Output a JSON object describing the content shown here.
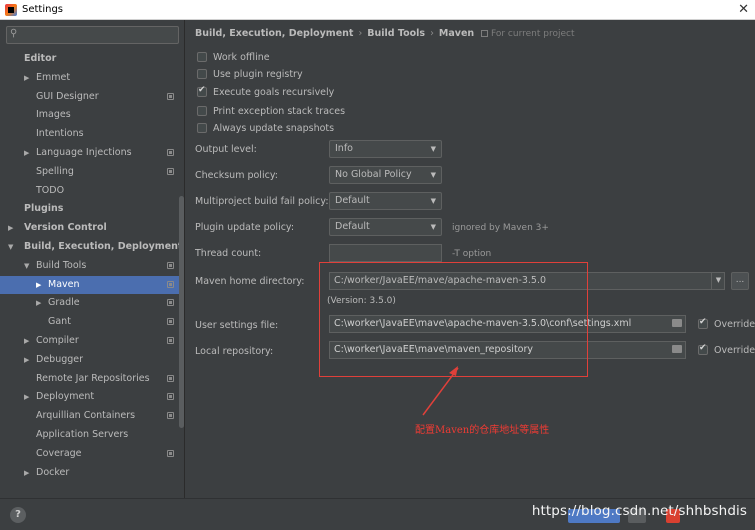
{
  "window": {
    "title": "Settings"
  },
  "search": {
    "placeholder": ""
  },
  "sidebar": {
    "items": [
      {
        "label": "Editor",
        "level": 0,
        "bold": true
      },
      {
        "label": "Emmet",
        "level": 1,
        "arrow": "right"
      },
      {
        "label": "GUI Designer",
        "level": 1,
        "copy": true
      },
      {
        "label": "Images",
        "level": 1
      },
      {
        "label": "Intentions",
        "level": 1
      },
      {
        "label": "Language Injections",
        "level": 1,
        "arrow": "right",
        "copy": true
      },
      {
        "label": "Spelling",
        "level": 1,
        "copy": true
      },
      {
        "label": "TODO",
        "level": 1
      },
      {
        "label": "Plugins",
        "level": 0,
        "bold": true
      },
      {
        "label": "Version Control",
        "level": 0,
        "bold": true,
        "arrow": "right"
      },
      {
        "label": "Build, Execution, Deployment",
        "level": 0,
        "bold": true,
        "arrow": "down"
      },
      {
        "label": "Build Tools",
        "level": 1,
        "arrow": "down",
        "copy": true
      },
      {
        "label": "Maven",
        "level": 2,
        "arrow": "right",
        "copy": true,
        "selected": true
      },
      {
        "label": "Gradle",
        "level": 2,
        "arrow": "right",
        "copy": true
      },
      {
        "label": "Gant",
        "level": 2,
        "copy": true
      },
      {
        "label": "Compiler",
        "level": 1,
        "arrow": "right",
        "copy": true
      },
      {
        "label": "Debugger",
        "level": 1,
        "arrow": "right"
      },
      {
        "label": "Remote Jar Repositories",
        "level": 1,
        "copy": true
      },
      {
        "label": "Deployment",
        "level": 1,
        "arrow": "right",
        "copy": true
      },
      {
        "label": "Arquillian Containers",
        "level": 1,
        "copy": true
      },
      {
        "label": "Application Servers",
        "level": 1
      },
      {
        "label": "Coverage",
        "level": 1,
        "copy": true
      },
      {
        "label": "Docker",
        "level": 1,
        "arrow": "right"
      }
    ]
  },
  "breadcrumb": {
    "items": [
      "Build, Execution, Deployment",
      "Build Tools",
      "Maven"
    ],
    "separator": "›",
    "scope": "For current project"
  },
  "checkboxes": [
    {
      "label": "Work offline",
      "checked": false
    },
    {
      "label": "Use plugin registry",
      "checked": false
    },
    {
      "label": "Execute goals recursively",
      "checked": true
    },
    {
      "label": "Print exception stack traces",
      "checked": false
    },
    {
      "label": "Always update snapshots",
      "checked": false
    }
  ],
  "fields": {
    "output_level": {
      "label": "Output level:",
      "value": "Info"
    },
    "checksum_policy": {
      "label": "Checksum policy:",
      "value": "No Global Policy"
    },
    "fail_policy": {
      "label": "Multiproject build fail policy:",
      "value": "Default"
    },
    "plugin_update": {
      "label": "Plugin update policy:",
      "value": "Default",
      "note": "ignored by Maven 3+"
    },
    "thread_count": {
      "label": "Thread count:",
      "value": "",
      "note": "-T option"
    },
    "maven_home": {
      "label": "Maven home directory:",
      "value": "C:/worker/JavaEE/mave/apache-maven-3.5.0",
      "version": "(Version: 3.5.0)"
    },
    "user_settings": {
      "label": "User settings file:",
      "value": "C:\\worker\\JavaEE\\mave\\apache-maven-3.5.0\\conf\\settings.xml",
      "override": "Override",
      "override_checked": true
    },
    "local_repo": {
      "label": "Local repository:",
      "value": "C:\\worker\\JavaEE\\mave\\maven_repository",
      "override": "Override",
      "override_checked": true
    }
  },
  "browse_button": {
    "label": "..."
  },
  "annotation": {
    "text": "配置Maven的仓库地址等属性",
    "color": "#ef3b34"
  },
  "help": {
    "label": "?"
  },
  "watermark": {
    "text": "https://blog.csdn.net/shhbshdis"
  },
  "colors": {
    "selection": "#4b6eaf",
    "background": "#3c3f41",
    "highlight_box": "#e0403a"
  }
}
